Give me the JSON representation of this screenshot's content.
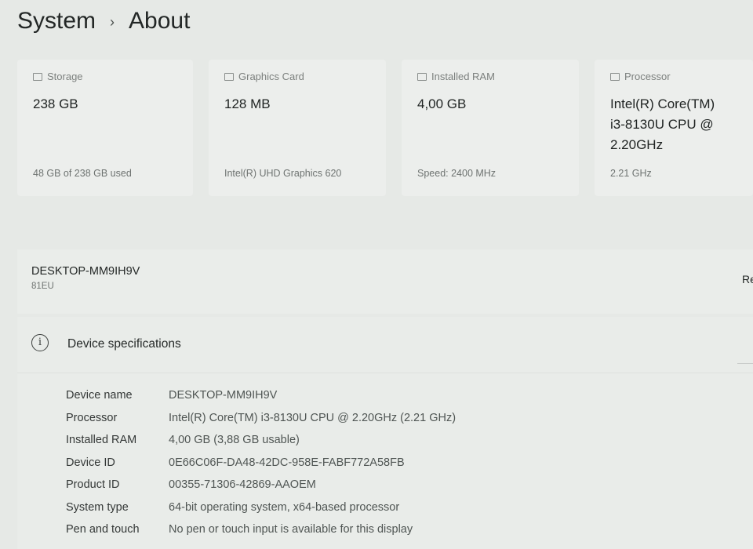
{
  "breadcrumb": {
    "parent": "System",
    "current": "About"
  },
  "cards": [
    {
      "label": "Storage",
      "icon": "storage-icon",
      "value": "238 GB",
      "sub": "48 GB of 238 GB used"
    },
    {
      "label": "Graphics Card",
      "icon": "graphics-card-icon",
      "value": "128 MB",
      "sub": "Intel(R) UHD Graphics 620"
    },
    {
      "label": "Installed RAM",
      "icon": "ram-icon",
      "value": "4,00 GB",
      "sub": "Speed: 2400 MHz"
    },
    {
      "label": "Processor",
      "icon": "processor-icon",
      "value_lines": [
        "Intel(R) Core(TM)",
        "i3-8130U CPU @",
        "2.20GHz"
      ],
      "sub": "2.21 GHz"
    }
  ],
  "device": {
    "name": "DESKTOP-MM9IH9V",
    "model": "81EU",
    "rename_button": "Re"
  },
  "specs": {
    "title": "Device specifications",
    "rows": [
      {
        "key": "Device name",
        "value": "DESKTOP-MM9IH9V"
      },
      {
        "key": "Processor",
        "value": "Intel(R) Core(TM) i3-8130U CPU @ 2.20GHz (2.21 GHz)"
      },
      {
        "key": "Installed RAM",
        "value": "4,00 GB (3,88 GB usable)"
      },
      {
        "key": "Device ID",
        "value": "0E66C06F-DA48-42DC-958E-FABF772A58FB"
      },
      {
        "key": "Product ID",
        "value": "00355-71306-42869-AAOEM"
      },
      {
        "key": "System type",
        "value": "64-bit operating system, x64-based processor"
      },
      {
        "key": "Pen and touch",
        "value": "No pen or touch input is available for this display"
      }
    ]
  }
}
